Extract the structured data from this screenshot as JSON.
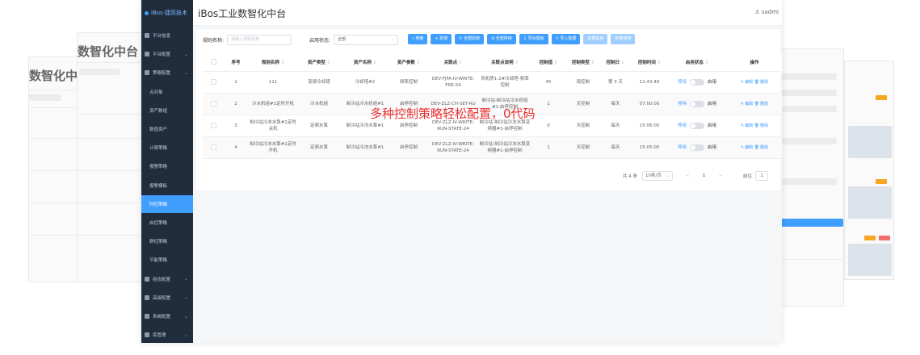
{
  "app": {
    "logo_text": "iBos·捷高技术",
    "title": "iBos工业数智化中台",
    "user": "sadmi"
  },
  "ghosts": {
    "title_a": "数智化中台",
    "title_b": "数智化中台"
  },
  "sidebar": {
    "items": [
      {
        "label": "平台信息",
        "parent": true
      },
      {
        "label": "平台配置",
        "parent": true
      },
      {
        "label": "策略配置",
        "parent": true
      },
      {
        "label": "点对象",
        "parent": false
      },
      {
        "label": "资产数组",
        "parent": false
      },
      {
        "label": "数值资产",
        "parent": false
      },
      {
        "label": "计算策略",
        "parent": false
      },
      {
        "label": "报警策略",
        "parent": false
      },
      {
        "label": "报警模板",
        "parent": false
      },
      {
        "label": "时控策略",
        "parent": false,
        "active": true
      },
      {
        "label": "启控策略",
        "parent": false
      },
      {
        "label": "群控策略",
        "parent": false
      },
      {
        "label": "节能策略",
        "parent": false
      },
      {
        "label": "组态配置",
        "parent": true
      },
      {
        "label": "高级配置",
        "parent": true
      },
      {
        "label": "系统配置",
        "parent": true
      },
      {
        "label": "库管理",
        "parent": true
      }
    ]
  },
  "filters": {
    "rule_name_label": "规则名称:",
    "rule_name_placeholder": "请输入规则名称",
    "status_label": "启用状态:",
    "status_value": "全部"
  },
  "toolbar": {
    "search": "搜索",
    "add": "新增",
    "enable_all": "全部启用",
    "disable_all": "全部停用",
    "export_template": "导出模板",
    "import_data": "导入数据",
    "batch_enable": "批量启用",
    "batch_disable": "批量停用"
  },
  "table": {
    "headers": [
      "序号",
      "规则名称",
      "资产类型",
      "资产名称",
      "资产参数",
      "关联点",
      "关联点说明",
      "控制值",
      "控制类型",
      "控制日",
      "控制时间",
      "启用状态",
      "操作"
    ],
    "rows": [
      {
        "no": "1",
        "rule": "111",
        "asset_type": "变频冷却塔",
        "asset_name": "冷却塔#2",
        "param": "频率控制",
        "point": "DEV-FJFA-IV-WRITE-FRE-54",
        "point_desc": "风机房1-2#冷却塔-频率控制",
        "value": "45",
        "ctrl_type": "周控制",
        "ctrl_day": "第 3 天",
        "ctrl_time": "12:43:49"
      },
      {
        "no": "2",
        "rule": "冷水机组#1定时开机",
        "asset_type": "冷水机组",
        "asset_name": "制冷站冷水机组#1",
        "param": "启停控制",
        "point": "DEV-ZLZ-CH-SET-RU",
        "point_desc": "制冷站-制冷站冷水机组#1-启停控制",
        "value": "1",
        "ctrl_type": "天控制",
        "ctrl_day": "每天",
        "ctrl_time": "07:00:00"
      },
      {
        "no": "3",
        "rule": "制冷站冷冻水泵#1定时关机",
        "asset_type": "定频水泵",
        "asset_name": "制冷站冷冻水泵#1",
        "param": "启停控制",
        "point": "DEV-ZLZ-IV-WRITE-RUN-STATE-24",
        "point_desc": "制冷站-制冷站冷冻水泵变频器#1-启停控制",
        "value": "0",
        "ctrl_type": "天控制",
        "ctrl_day": "每天",
        "ctrl_time": "15:06:00"
      },
      {
        "no": "4",
        "rule": "制冷站冷冻水泵#1定时开机",
        "asset_type": "定频水泵",
        "asset_name": "制冷站冷冻水泵#1",
        "param": "启停控制",
        "point": "DEV-ZLZ-IV-WRITE-RUN-STATE-24",
        "point_desc": "制冷站-制冷站冷冻水泵变频器#1-启停控制",
        "value": "1",
        "ctrl_type": "天控制",
        "ctrl_day": "每天",
        "ctrl_time": "15:05:00"
      }
    ],
    "disable_label": "停用",
    "enable_label": "启用",
    "edit_label": "编辑",
    "delete_label": "删除"
  },
  "pager": {
    "total": "共 4 条",
    "page_size": "10条/页",
    "prev": "<",
    "current": "1",
    "next": ">",
    "goto_label": "前往",
    "goto_value": "1"
  },
  "overlay_caption": "多种控制策略轻松配置，0代码",
  "colors": {
    "primary": "#409eff",
    "sidebar_bg": "#1f2d3d",
    "overlay_red": "#e8302f"
  }
}
